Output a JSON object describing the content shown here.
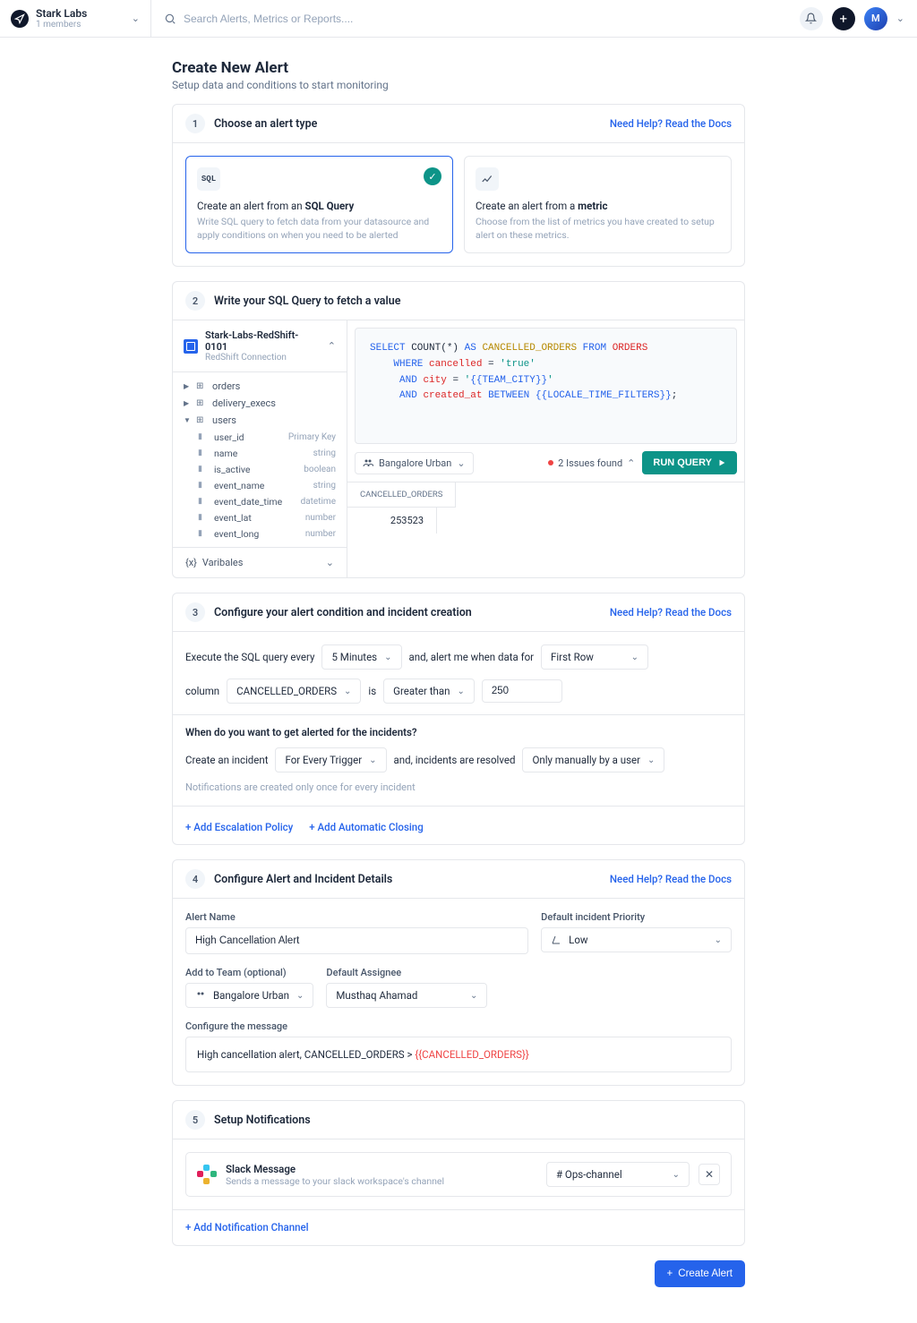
{
  "header": {
    "workspace_name": "Stark Labs",
    "workspace_sub": "1 members",
    "search_placeholder": "Search Alerts, Metrics or Reports...."
  },
  "page": {
    "title": "Create New Alert",
    "subtitle": "Setup data and conditions to start monitoring"
  },
  "help_link": "Need Help? Read the Docs",
  "step1": {
    "title": "Choose an alert type",
    "sql": {
      "icon_label": "SQL",
      "title_prefix": "Create an alert from an ",
      "title_bold": "SQL Query",
      "desc": "Write SQL query to fetch data from your datasource and apply conditions on when you need to be alerted"
    },
    "metric": {
      "title_prefix": "Create an alert from a ",
      "title_bold": "metric",
      "desc": "Choose from the list of metrics you have created to setup alert on these metrics."
    }
  },
  "step2": {
    "title": "Write your SQL Query to fetch a value",
    "ds_name": "Stark-Labs-RedShift-0101",
    "ds_type": "RedShift Connection",
    "tables": {
      "orders": "orders",
      "delivery_execs": "delivery_execs",
      "users": "users"
    },
    "columns": [
      {
        "name": "user_id",
        "type": "Primary Key"
      },
      {
        "name": "name",
        "type": "string"
      },
      {
        "name": "is_active",
        "type": "boolean"
      },
      {
        "name": "event_name",
        "type": "string"
      },
      {
        "name": "event_date_time",
        "type": "datetime"
      },
      {
        "name": "event_lat",
        "type": "number"
      },
      {
        "name": "event_long",
        "type": "number"
      }
    ],
    "variables_label": "Varibales",
    "team_chip": "Bangalore Urban",
    "issues_text": "2 Issues found",
    "run_label": "RUN QUERY",
    "result_header": "CANCELLED_ORDERS",
    "result_value": "253523"
  },
  "step3": {
    "title": "Configure your alert condition and incident creation",
    "exec_prefix": "Execute the SQL query every",
    "interval": "5 Minutes",
    "alert_prefix": "and, alert me when data for",
    "row_sel": "First Row",
    "col_label": "column",
    "col_sel": "CANCELLED_ORDERS",
    "is_label": "is",
    "op_sel": "Greater than",
    "threshold": "250",
    "incident_q": "When do you want to get alerted for the incidents?",
    "create_incident": "Create an incident",
    "trigger_sel": "For Every Trigger",
    "resolved_prefix": "and, incidents are resolved",
    "resolved_sel": "Only manually by a user",
    "note": "Notifications are created only once for every incident",
    "escalation_link": "+ Add Escalation Policy",
    "auto_close_link": "+ Add Automatic Closing"
  },
  "step4": {
    "title": "Configure Alert and Incident Details",
    "name_label": "Alert Name",
    "name_value": "High Cancellation Alert",
    "priority_label": "Default incident Priority",
    "priority_value": "Low",
    "team_label": "Add to Team (optional)",
    "team_value": "Bangalore Urban",
    "assignee_label": "Default Assignee",
    "assignee_value": "Musthaq Ahamad",
    "msg_label": "Configure the message",
    "msg_text": "High cancellation alert, CANCELLED_ORDERS > ",
    "msg_var": "{{CANCELLED_ORDERS}}"
  },
  "step5": {
    "title": "Setup Notifications",
    "slack_title": "Slack Message",
    "slack_sub": "Sends a message to your slack workspace's channel",
    "channel": "# Ops-channel",
    "add_channel": "+ Add Notification Channel"
  },
  "footer": {
    "create_label": "Create Alert"
  }
}
